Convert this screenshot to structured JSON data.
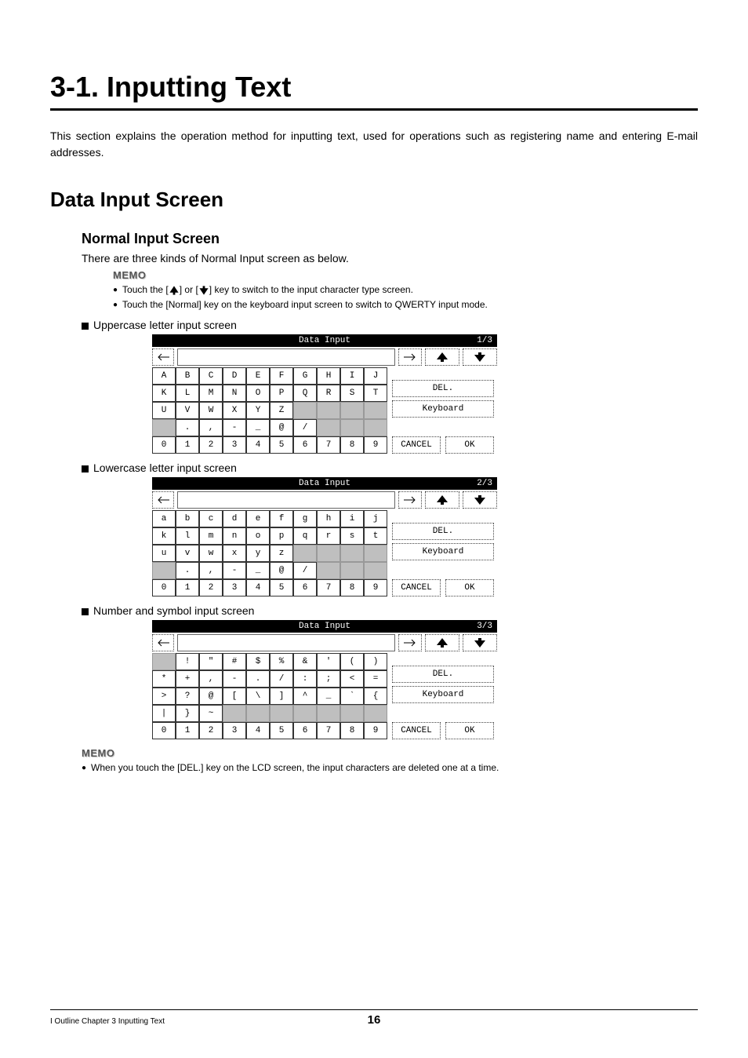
{
  "title": "3-1. Inputting Text",
  "intro": "This section explains the operation method for inputting text, used for operations such as registering name and entering E-mail addresses.",
  "h2": "Data Input Screen",
  "h3": "Normal Input Screen",
  "h3_body": "There are three kinds of Normal Input screen as below.",
  "memo_label": "MEMO",
  "memo1_a_pre": "Touch the [",
  "memo1_a_mid": "] or [",
  "memo1_a_post": "] key to switch to the input character type screen.",
  "memo1_b": "Touch the [Normal] key on the keyboard input screen to switch to QWERTY input mode.",
  "memo2": "When you touch the [DEL.] key on the LCD screen, the input characters are deleted one at a time.",
  "sec_upper": "Uppercase letter input screen",
  "sec_lower": "Lowercase letter input screen",
  "sec_sym": "Number and symbol input screen",
  "kb": {
    "header_title": "Data Input",
    "del": "DEL.",
    "keyboard": "Keyboard",
    "cancel": "CANCEL",
    "ok": "OK",
    "digits": [
      "0",
      "1",
      "2",
      "3",
      "4",
      "5",
      "6",
      "7",
      "8",
      "9"
    ]
  },
  "kb_upper": {
    "page": "1/3",
    "r1": [
      "A",
      "B",
      "C",
      "D",
      "E",
      "F",
      "G",
      "H",
      "I",
      "J"
    ],
    "r2": [
      "K",
      "L",
      "M",
      "N",
      "O",
      "P",
      "Q",
      "R",
      "S",
      "T"
    ],
    "r3": [
      "U",
      "V",
      "W",
      "X",
      "Y",
      "Z",
      "",
      "",
      "",
      ""
    ],
    "r4": [
      "",
      ".",
      ",",
      "-",
      "_",
      "@",
      "/",
      "",
      "",
      ""
    ]
  },
  "kb_lower": {
    "page": "2/3",
    "r1": [
      "a",
      "b",
      "c",
      "d",
      "e",
      "f",
      "g",
      "h",
      "i",
      "j"
    ],
    "r2": [
      "k",
      "l",
      "m",
      "n",
      "o",
      "p",
      "q",
      "r",
      "s",
      "t"
    ],
    "r3": [
      "u",
      "v",
      "w",
      "x",
      "y",
      "z",
      "",
      "",
      "",
      ""
    ],
    "r4": [
      "",
      ".",
      ",",
      "-",
      "_",
      "@",
      "/",
      "",
      "",
      ""
    ]
  },
  "kb_sym": {
    "page": "3/3",
    "r1": [
      "",
      "!",
      "\"",
      "#",
      "$",
      "%",
      "&",
      "'",
      "(",
      ")"
    ],
    "r2": [
      "*",
      "+",
      ",",
      "-",
      ".",
      "/",
      ":",
      ";",
      "<",
      "="
    ],
    "r3": [
      ">",
      "?",
      "@",
      "[",
      "\\",
      "]",
      "^",
      "_",
      "`",
      "{"
    ],
    "r4": [
      "|",
      "}",
      "~",
      "",
      "",
      "",
      "",
      "",
      "",
      ""
    ]
  },
  "footer": {
    "left": "I Outline Chapter 3 Inputting Text",
    "page": "16"
  }
}
